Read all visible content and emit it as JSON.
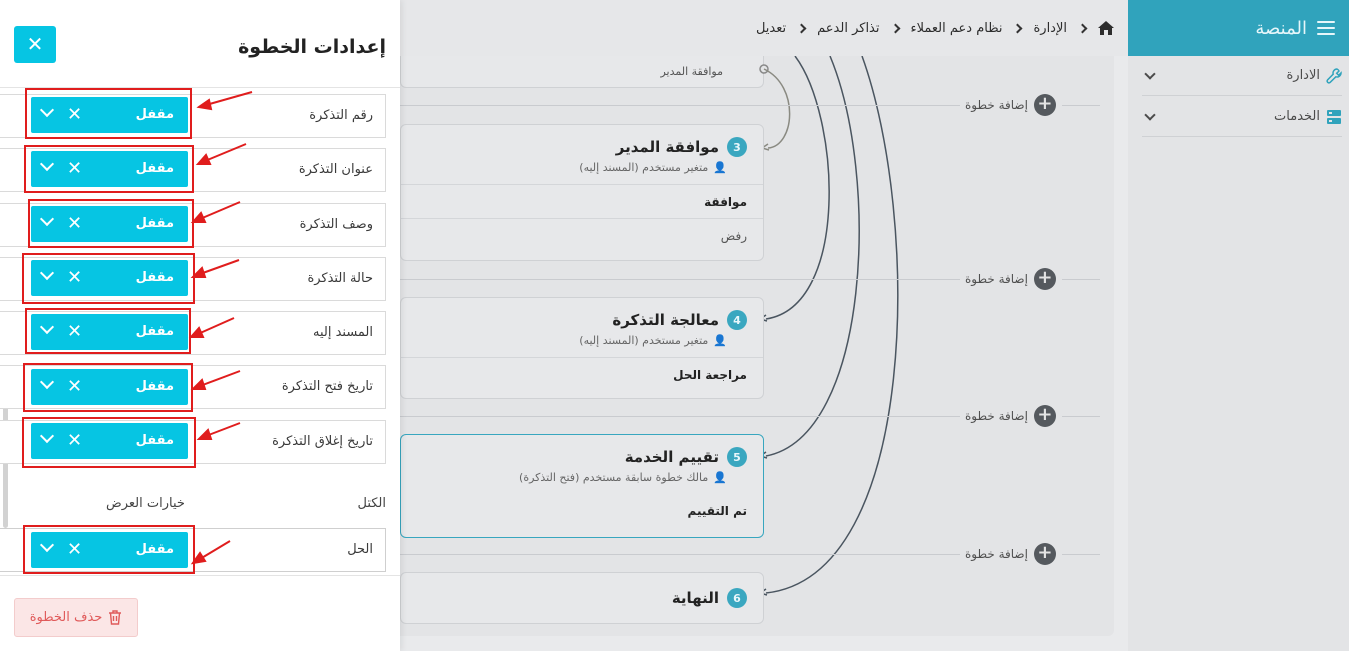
{
  "sidebar": {
    "title": "المنصة",
    "items": [
      {
        "label": "الادارة",
        "icon": "wrench-icon"
      },
      {
        "label": "الخدمات",
        "icon": "services-icon"
      }
    ]
  },
  "breadcrumb": [
    "الإدارة",
    "نظام دعم العملاء",
    "تذاكر الدعم",
    "تعديل"
  ],
  "canvas": {
    "top_step_text": "موافقة المدير",
    "add_step_label": "إضافة خطوة",
    "steps": [
      {
        "number": "3",
        "title": "موافقة المدير",
        "subtitle": "متغير مستخدم (المسند إليه)",
        "rows": [
          "موافقة",
          "رفض"
        ]
      },
      {
        "number": "4",
        "title": "معالجة التذكرة",
        "subtitle": "متغير مستخدم (المسند إليه)",
        "rows": [
          "مراجعة الحل"
        ]
      },
      {
        "number": "5",
        "title": "تقييم الخدمة",
        "subtitle": "مالك خطوة سابقة مستخدم (فتح التذكرة)",
        "rows": [
          "تم التقييم"
        ]
      },
      {
        "number": "6",
        "title": "النهاية",
        "subtitle": "",
        "rows": []
      }
    ]
  },
  "panel": {
    "title": "إعدادات الخطوة",
    "close_symbol": "✕",
    "locked_label": "مقفل",
    "fields": [
      "رقم التذكرة",
      "عنوان التذكرة",
      "وصف التذكرة",
      "حالة التذكرة",
      "المسند إليه",
      "تاريخ فتح التذكرة",
      "تاريخ إغلاق التذكرة"
    ],
    "columns": {
      "blocks": "الكتل",
      "display_options": "خيارات العرض"
    },
    "block_fields": [
      "الحل"
    ],
    "delete_label": "حذف الخطوة"
  },
  "colors": {
    "accent": "#06c5e3",
    "header": "#30a3bc",
    "annotation": "#e01d1d",
    "danger": "#e05a5a"
  }
}
